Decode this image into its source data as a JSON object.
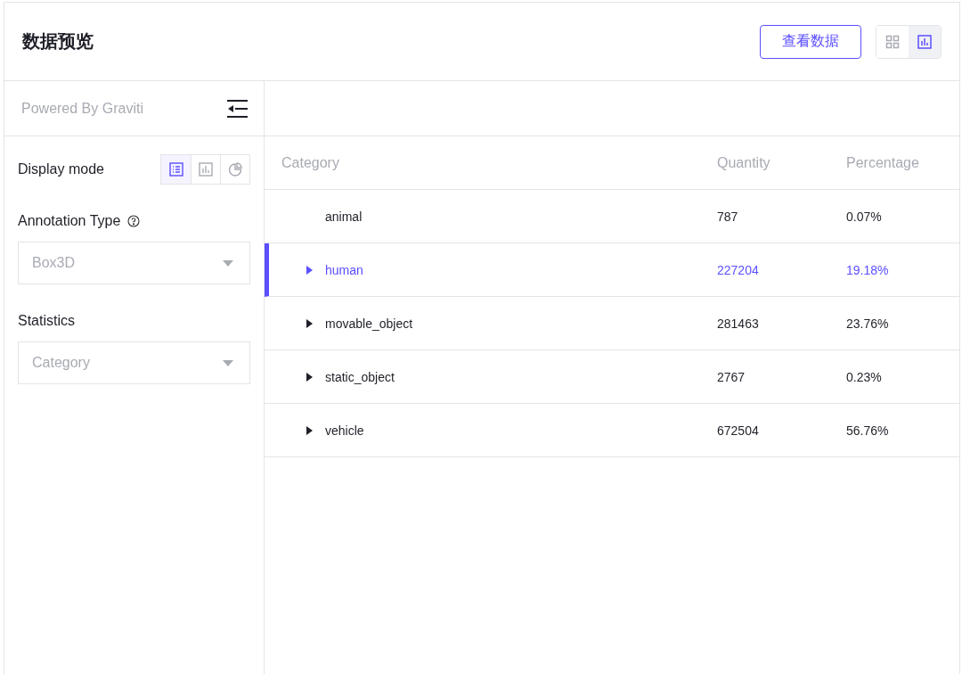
{
  "header": {
    "title": "数据预览",
    "action_button": "查看数据",
    "view_toggle": [
      {
        "kind": "grid",
        "selected": false
      },
      {
        "kind": "chart",
        "selected": true
      }
    ]
  },
  "sidebar": {
    "powered_by": "Powered By Graviti",
    "display_mode": {
      "label": "Display mode",
      "options": [
        {
          "kind": "list",
          "selected": true
        },
        {
          "kind": "bar",
          "selected": false
        },
        {
          "kind": "pie",
          "selected": false
        }
      ]
    },
    "annotation_type": {
      "label": "Annotation Type",
      "value": "Box3D"
    },
    "statistics": {
      "label": "Statistics",
      "placeholder": "Category"
    }
  },
  "table": {
    "columns": [
      "Category",
      "Quantity",
      "Percentage"
    ],
    "rows": [
      {
        "category": "animal",
        "quantity": "787",
        "percentage": "0.07%",
        "expandable": false,
        "selected": false
      },
      {
        "category": "human",
        "quantity": "227204",
        "percentage": "19.18%",
        "expandable": true,
        "selected": true
      },
      {
        "category": "movable_object",
        "quantity": "281463",
        "percentage": "23.76%",
        "expandable": true,
        "selected": false
      },
      {
        "category": "static_object",
        "quantity": "2767",
        "percentage": "0.23%",
        "expandable": true,
        "selected": false
      },
      {
        "category": "vehicle",
        "quantity": "672504",
        "percentage": "56.76%",
        "expandable": true,
        "selected": false
      }
    ]
  }
}
